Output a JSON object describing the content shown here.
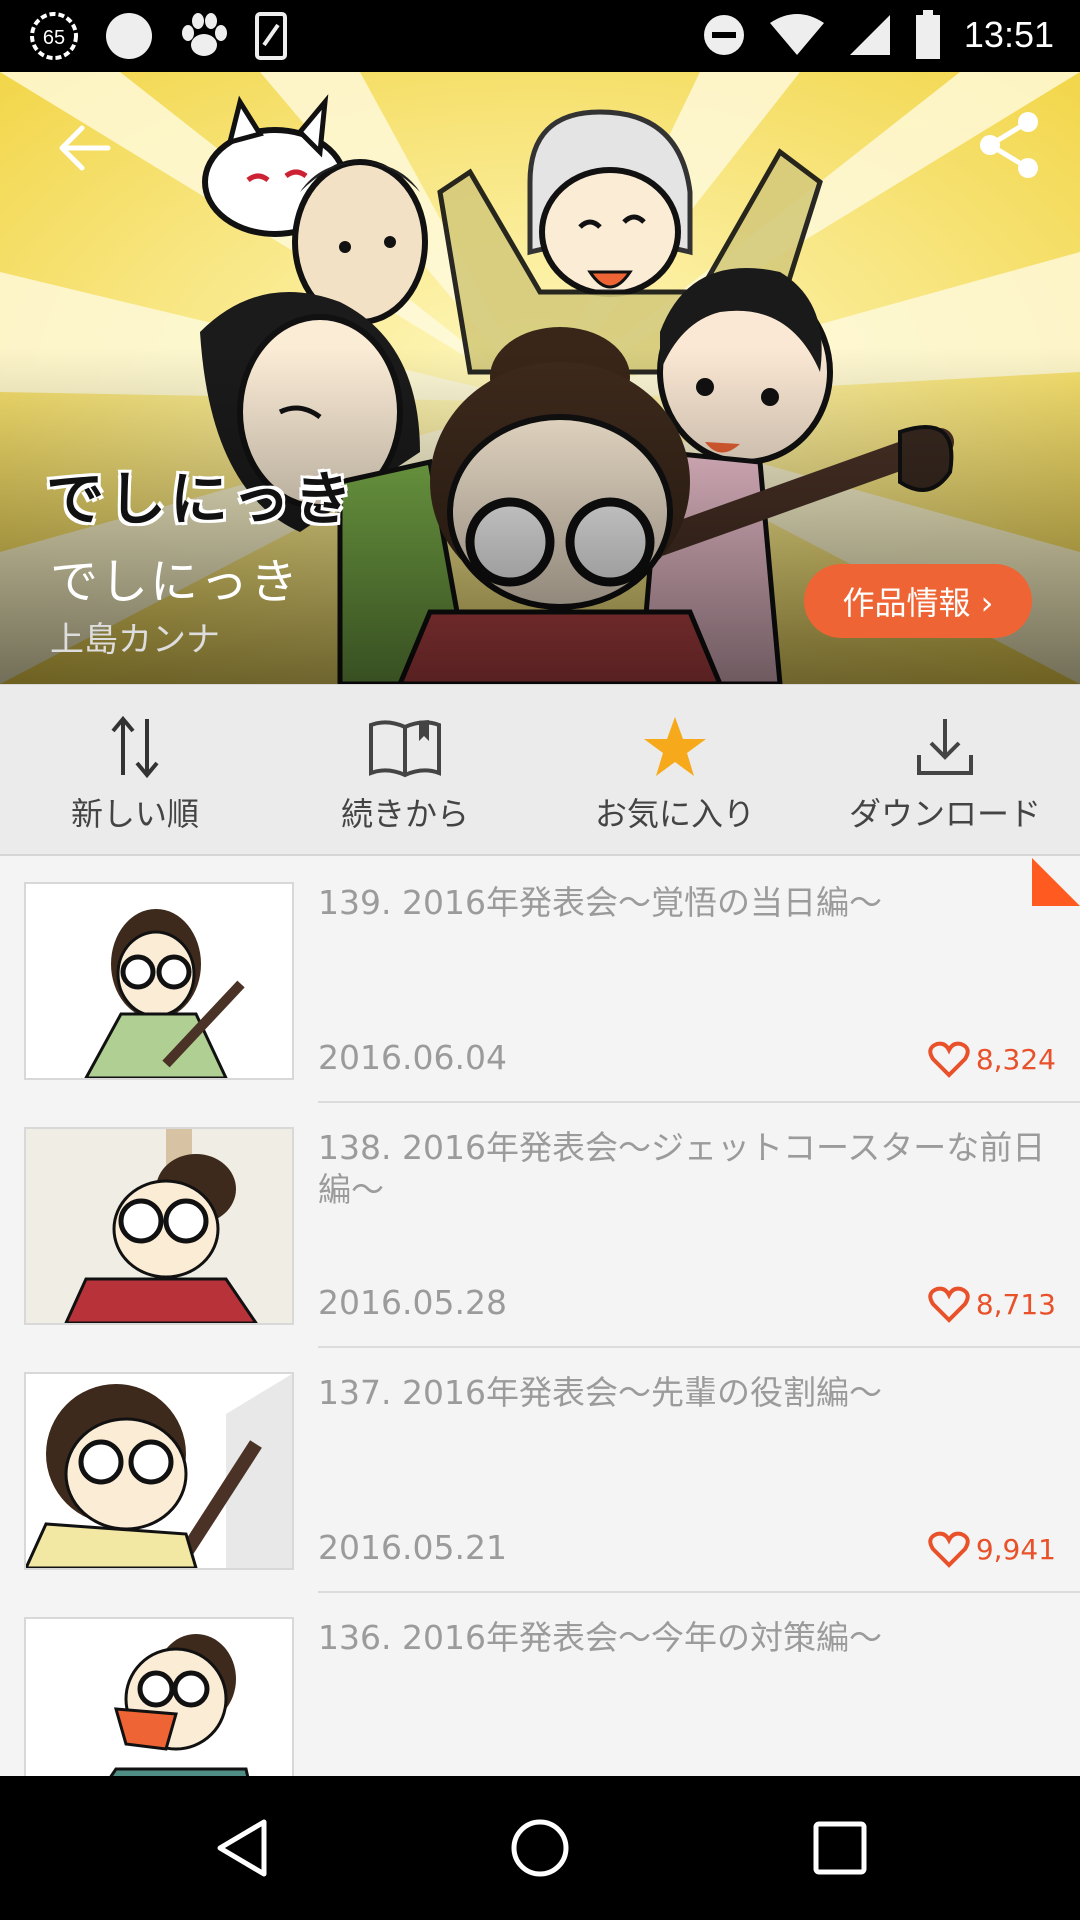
{
  "status_bar": {
    "notification_badge": "65",
    "time": "13:51"
  },
  "hero": {
    "logo_text": "でしにっき",
    "title": "でしにっき",
    "author": "上島カンナ",
    "info_button": "作品情報 ›"
  },
  "toolbar": {
    "items": [
      {
        "label": "新しい順",
        "icon": "sort-arrows-icon"
      },
      {
        "label": "続きから",
        "icon": "book-icon"
      },
      {
        "label": "お気に入り",
        "icon": "star-icon"
      },
      {
        "label": "ダウンロード",
        "icon": "download-icon"
      }
    ]
  },
  "episodes": [
    {
      "title": "139. 2016年発表会〜覚悟の当日編〜",
      "date": "2016.06.04",
      "likes": "8,324"
    },
    {
      "title": "138. 2016年発表会〜ジェットコースターな前日編〜",
      "date": "2016.05.28",
      "likes": "8,713"
    },
    {
      "title": "137. 2016年発表会〜先輩の役割編〜",
      "date": "2016.05.21",
      "likes": "9,941"
    },
    {
      "title": "136. 2016年発表会〜今年の対策編〜",
      "date": "",
      "likes": ""
    }
  ],
  "colors": {
    "accent": "#ee6434",
    "like": "#e8512a",
    "star": "#f6a91b"
  }
}
